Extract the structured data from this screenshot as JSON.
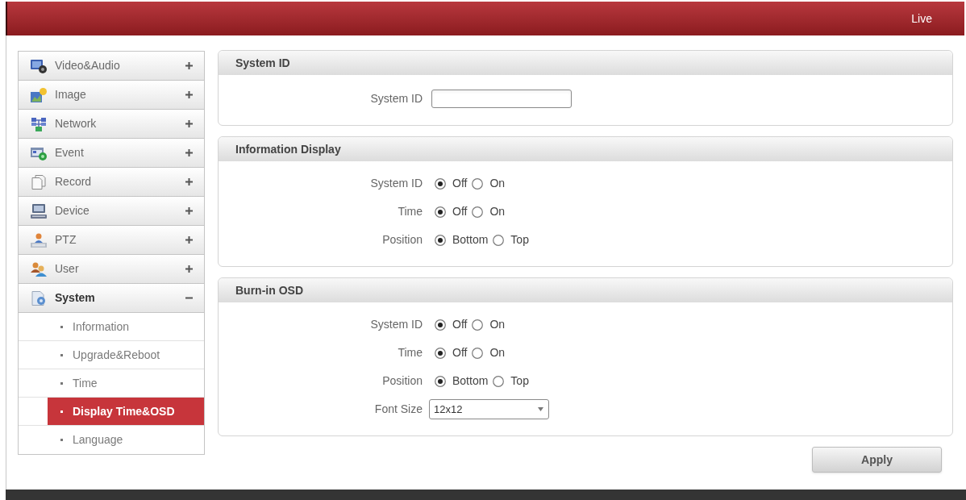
{
  "header": {
    "link": "Live"
  },
  "sidebar": {
    "items": [
      {
        "label": "Video&Audio",
        "expanded": false
      },
      {
        "label": "Image",
        "expanded": false
      },
      {
        "label": "Network",
        "expanded": false
      },
      {
        "label": "Event",
        "expanded": false
      },
      {
        "label": "Record",
        "expanded": false
      },
      {
        "label": "Device",
        "expanded": false
      },
      {
        "label": "PTZ",
        "expanded": false
      },
      {
        "label": "User",
        "expanded": false
      },
      {
        "label": "System",
        "expanded": true,
        "children": [
          {
            "label": "Information",
            "selected": false
          },
          {
            "label": "Upgrade&Reboot",
            "selected": false
          },
          {
            "label": "Time",
            "selected": false
          },
          {
            "label": "Display Time&OSD",
            "selected": true
          },
          {
            "label": "Language",
            "selected": false
          }
        ]
      }
    ]
  },
  "panels": [
    {
      "title": "System ID",
      "rows": [
        {
          "kind": "text",
          "label": "System ID"
        }
      ]
    },
    {
      "title": "Information Display",
      "rows": [
        {
          "kind": "radio",
          "label": "System ID",
          "options": [
            {
              "label": "Off",
              "selected": true
            },
            {
              "label": "On",
              "selected": false
            }
          ]
        },
        {
          "kind": "radio",
          "label": "Time",
          "options": [
            {
              "label": "Off",
              "selected": true
            },
            {
              "label": "On",
              "selected": false
            }
          ]
        },
        {
          "kind": "radio",
          "label": "Position",
          "options": [
            {
              "label": "Bottom",
              "selected": true
            },
            {
              "label": "Top",
              "selected": false
            }
          ]
        }
      ]
    },
    {
      "title": "Burn-in OSD",
      "rows": [
        {
          "kind": "radio",
          "label": "System ID",
          "options": [
            {
              "label": "Off",
              "selected": true
            },
            {
              "label": "On",
              "selected": false
            }
          ]
        },
        {
          "kind": "radio",
          "label": "Time",
          "options": [
            {
              "label": "Off",
              "selected": true
            },
            {
              "label": "On",
              "selected": false
            }
          ]
        },
        {
          "kind": "radio",
          "label": "Position",
          "options": [
            {
              "label": "Bottom",
              "selected": true
            },
            {
              "label": "Top",
              "selected": false
            }
          ]
        },
        {
          "kind": "select",
          "label": "Font Size",
          "value": "12x12"
        }
      ]
    }
  ],
  "apply_button": "Apply"
}
